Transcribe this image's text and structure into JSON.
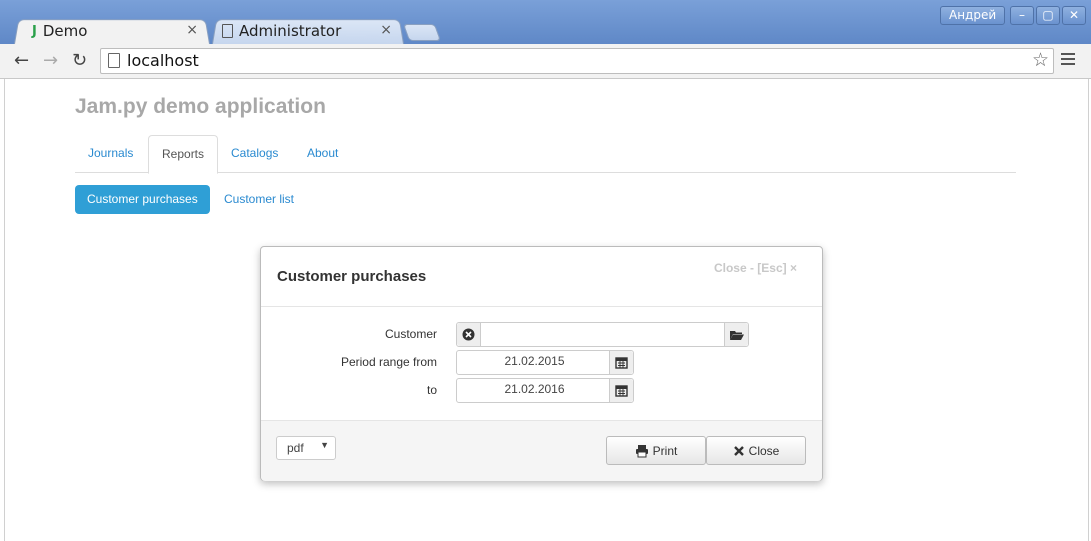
{
  "browser": {
    "tabs": [
      {
        "label": "Demo",
        "favicon": "J"
      },
      {
        "label": "Administrator"
      }
    ],
    "tab_close": "×",
    "user_button": "Андрей",
    "window_controls": [
      "–",
      "▢",
      "✕"
    ],
    "url": "localhost"
  },
  "app": {
    "title": "Jam.py demo application",
    "nav_tabs": [
      "Journals",
      "Reports",
      "Catalogs",
      "About"
    ],
    "active_tab": "Reports",
    "sub_nav": [
      "Customer purchases",
      "Customer list"
    ]
  },
  "dialog": {
    "title": "Customer purchases",
    "close_hint": "Close - [Esc] ×",
    "fields": {
      "customer_label": "Customer",
      "customer_value": "",
      "period_from_label": "Period range from",
      "period_from_value": "21.02.2015",
      "period_to_label": "to",
      "period_to_value": "21.02.2016"
    },
    "format_select": {
      "value": "pdf"
    },
    "print_label": "Print",
    "close_label": "Close"
  },
  "colors": {
    "accent": "#2f9fd6",
    "link": "#2a8ad0"
  }
}
